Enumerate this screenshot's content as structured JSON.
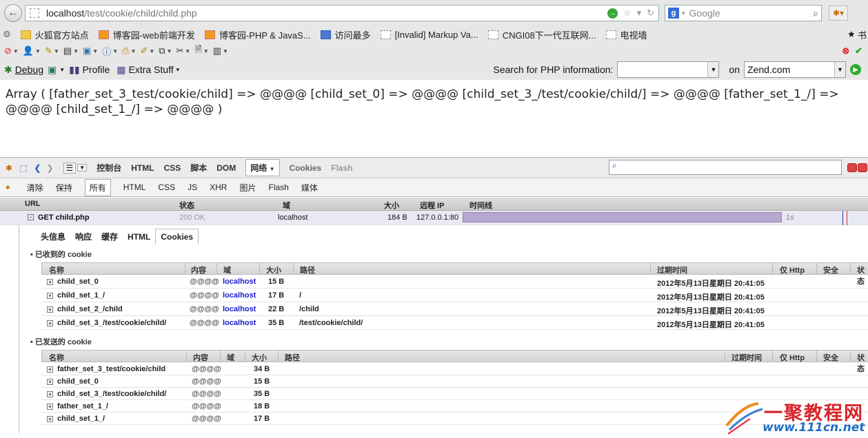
{
  "browser": {
    "url_host": "localhost",
    "url_path": "/test/cookie/child/child.php",
    "search_engine": "Google"
  },
  "bookmarks": [
    {
      "icon": "folder",
      "label": "火狐官方站点"
    },
    {
      "icon": "rss",
      "label": "博客园-web前端开发"
    },
    {
      "icon": "rss",
      "label": "博客园-PHP & JavaS..."
    },
    {
      "icon": "blue",
      "label": "访问最多"
    },
    {
      "icon": "blank",
      "label": "[Invalid] Markup Va..."
    },
    {
      "icon": "blank",
      "label": "CNGI08下一代互联网..."
    },
    {
      "icon": "blank",
      "label": "电视墙"
    }
  ],
  "bookmarks_overflow": "书",
  "toolbar2": {
    "debug": "Debug",
    "profile": "Profile",
    "extra": "Extra Stuff",
    "php_search_label": "Search for PHP information:",
    "on": "on",
    "site": "Zend.com"
  },
  "page_output": "Array ( [father_set_3_test/cookie/child] => @@@@ [child_set_0] => @@@@ [child_set_3_/test/cookie/child/] => @@@@ [father_set_1_/] => @@@@ [child_set_1_/] => @@@@ )",
  "firebug": {
    "main_tabs": [
      "控制台",
      "HTML",
      "CSS",
      "脚本",
      "DOM",
      "网络",
      "Cookies",
      "Flash"
    ],
    "active_tab": "网络",
    "sub_tabs": [
      "清除",
      "保持",
      "所有",
      "HTML",
      "CSS",
      "JS",
      "XHR",
      "图片",
      "Flash",
      "媒体"
    ],
    "net_columns": [
      "URL",
      "状态",
      "域",
      "大小",
      "远程 IP",
      "时间线"
    ],
    "request": {
      "method_url": "GET child.php",
      "status": "200 OK",
      "domain": "localhost",
      "size": "184 B",
      "remote_ip": "127.0.0.1:80",
      "time": "1s"
    },
    "detail_tabs": [
      "头信息",
      "响应",
      "缓存",
      "HTML",
      "Cookies"
    ],
    "received_title": "已收到的 cookie",
    "received_columns": [
      "名称",
      "内容",
      "域",
      "大小",
      "路径",
      "过期时间",
      "仅 Http",
      "安全",
      "状态"
    ],
    "received": [
      {
        "name": "child_set_0",
        "value": "@@@@",
        "domain": "localhost",
        "size": "15 B",
        "path": "",
        "expires": "2012年5月13日星期日 20:41:05"
      },
      {
        "name": "child_set_1_/",
        "value": "@@@@",
        "domain": "localhost",
        "size": "17 B",
        "path": "/",
        "expires": "2012年5月13日星期日 20:41:05"
      },
      {
        "name": "child_set_2_/child",
        "value": "@@@@",
        "domain": "localhost",
        "size": "22 B",
        "path": "/child",
        "expires": "2012年5月13日星期日 20:41:05"
      },
      {
        "name": "child_set_3_/test/cookie/child/",
        "value": "@@@@",
        "domain": "localhost",
        "size": "35 B",
        "path": "/test/cookie/child/",
        "expires": "2012年5月13日星期日 20:41:05"
      }
    ],
    "sent_title": "已发送的 cookie",
    "sent_columns": [
      "名称",
      "内容",
      "域",
      "大小",
      "路径",
      "过期时间",
      "仅 Http",
      "安全",
      "状态"
    ],
    "sent": [
      {
        "name": "father_set_3_test/cookie/child",
        "value": "@@@@",
        "size": "34 B"
      },
      {
        "name": "child_set_0",
        "value": "@@@@",
        "size": "15 B"
      },
      {
        "name": "child_set_3_/test/cookie/child/",
        "value": "@@@@",
        "size": "35 B"
      },
      {
        "name": "father_set_1_/",
        "value": "@@@@",
        "size": "18 B"
      },
      {
        "name": "child_set_1_/",
        "value": "@@@@",
        "size": "17 B"
      }
    ]
  },
  "watermark": {
    "title": "一聚教程网",
    "url": "www.111cn.net"
  }
}
